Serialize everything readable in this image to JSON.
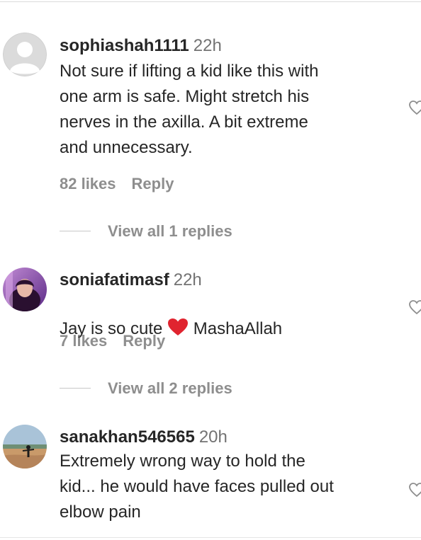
{
  "comments": [
    {
      "username": "sophiashah1111",
      "time": "22h",
      "text": "Not sure if lifting a kid like this with\none arm is safe. Might stretch his\nnerves in the axilla. A bit extreme\nand unnecessary.",
      "likes": "82 likes",
      "reply": "Reply",
      "view_replies": "View all 1 replies"
    },
    {
      "username": "soniafatimasf",
      "time": "22h",
      "text_before": "Jay is so cute ",
      "text_after": " MashaAllah",
      "likes": "7 likes",
      "reply": "Reply",
      "view_replies": "View all 2 replies"
    },
    {
      "username": "sanakhan546565",
      "time": "20h",
      "text": "Extremely wrong way to hold the\nkid... he would have faces pulled out\nelbow pain"
    }
  ],
  "colors": {
    "primary_text": "#262626",
    "secondary_text": "#8e8e8e",
    "heart_emoji": "#e0242f"
  },
  "icons": {
    "like": "heart-outline-icon",
    "emoji": "red-heart-emoji"
  }
}
